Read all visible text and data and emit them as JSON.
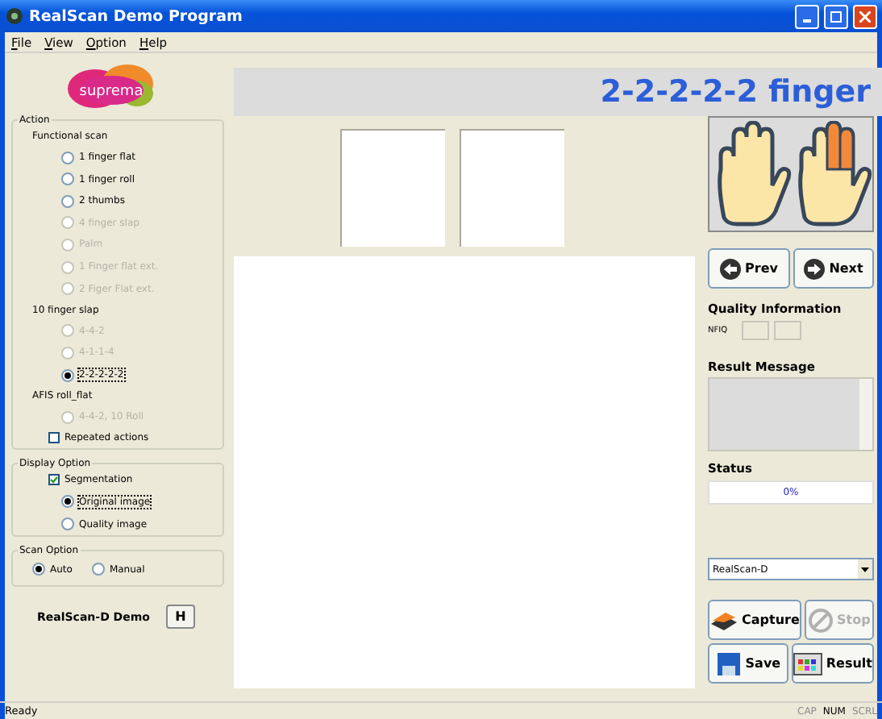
{
  "window": {
    "title": "RealScan Demo Program"
  },
  "menu": [
    "File",
    "View",
    "Option",
    "Help"
  ],
  "logo": {
    "text": "suprema"
  },
  "action_group": {
    "title": "Action",
    "items": [
      {
        "kind": "heading",
        "label": "Functional scan"
      },
      {
        "kind": "radio",
        "label": "1 finger flat",
        "selected": false,
        "disabled": false
      },
      {
        "kind": "radio",
        "label": "1 finger roll",
        "selected": false,
        "disabled": false
      },
      {
        "kind": "radio",
        "label": "2 thumbs",
        "selected": false,
        "disabled": false
      },
      {
        "kind": "radio",
        "label": "4 finger slap",
        "selected": false,
        "disabled": true
      },
      {
        "kind": "radio",
        "label": "Palm",
        "selected": false,
        "disabled": true
      },
      {
        "kind": "radio",
        "label": "1 Finger flat ext.",
        "selected": false,
        "disabled": true
      },
      {
        "kind": "radio",
        "label": "2 Figer Flat ext.",
        "selected": false,
        "disabled": true
      },
      {
        "kind": "heading",
        "label": "10 finger slap"
      },
      {
        "kind": "radio",
        "label": "4-4-2",
        "selected": false,
        "disabled": true
      },
      {
        "kind": "radio",
        "label": "4-1-1-4",
        "selected": false,
        "disabled": true
      },
      {
        "kind": "radio",
        "label": "2-2-2-2-2",
        "selected": true,
        "disabled": false
      },
      {
        "kind": "heading",
        "label": "AFIS roll_flat"
      },
      {
        "kind": "radio",
        "label": "4-4-2, 10 Roll",
        "selected": false,
        "disabled": true
      },
      {
        "kind": "checkbox",
        "label": "Repeated actions",
        "checked": false
      }
    ]
  },
  "display_group": {
    "title": "Display Option",
    "items": [
      {
        "kind": "checkbox",
        "label": "Segmentation",
        "checked": true
      },
      {
        "kind": "radio",
        "label": "Original image",
        "selected": true,
        "disabled": false
      },
      {
        "kind": "radio",
        "label": "Quality image",
        "selected": false,
        "disabled": false
      }
    ]
  },
  "scan_group": {
    "title": "Scan Option",
    "options": [
      {
        "label": "Auto",
        "selected": true
      },
      {
        "label": "Manual",
        "selected": false
      }
    ]
  },
  "device_label": "RealScan-D Demo",
  "h_button": "H",
  "mode_title": "2-2-2-2-2 finger",
  "nav_buttons": [
    {
      "kind": "prev",
      "label": "Prev"
    },
    {
      "kind": "next",
      "label": "Next"
    }
  ],
  "quality": {
    "title": "Quality Information",
    "label": "NFIQ"
  },
  "result_message": {
    "title": "Result Message"
  },
  "status": {
    "title": "Status",
    "level": 0,
    "reading": "0%"
  },
  "device_select": {
    "value": "RealScan-D"
  },
  "action_buttons": [
    {
      "kind": "capture",
      "label": "Capture",
      "disabled": false
    },
    {
      "kind": "stop",
      "label": "Stop",
      "disabled": true
    },
    {
      "kind": "save",
      "label": "Save",
      "disabled": false
    },
    {
      "kind": "result",
      "label": "Result",
      "disabled": false
    }
  ],
  "status_bar": {
    "text": "Ready",
    "indicators": [
      {
        "label": "CAP",
        "on": false
      },
      {
        "label": "NUM",
        "on": true
      },
      {
        "label": "SCRL",
        "on": false
      }
    ]
  }
}
